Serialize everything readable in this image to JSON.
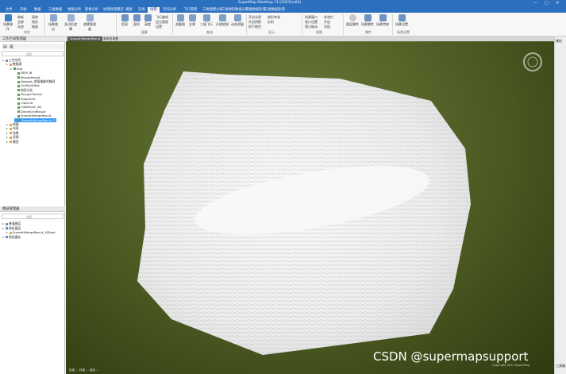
{
  "window": {
    "title": "SuperMap iDesktop 11i(2023)(x64)",
    "controls": [
      "—",
      "□",
      "✕"
    ]
  },
  "menu": {
    "tabs": [
      "文件",
      "开始",
      "数据",
      "三维数据",
      "地图分析",
      "影像分析",
      "地理处理模型",
      "视图",
      "在线",
      "场景",
      "空间分析",
      "飞行管理",
      "三维建模分析",
      "三维地形数据分析",
      "三维数据处理",
      "三维数据处理"
    ],
    "active_index": 9
  },
  "ribbon": {
    "items_col1": [
      "刷新",
      "全屏",
      "动态"
    ],
    "items_col2": [
      "清除",
      "地形",
      "缩放"
    ],
    "big_buttons": [
      "场景操作",
      "场景输出",
      "多边形遮罩",
      "遮罩管理器",
      "距离",
      "面积",
      "高度",
      "测量图",
      "全景",
      "三维飞行",
      "开放地图",
      "动态测量",
      "视频投放"
    ],
    "col_a": [
      "飞行路线",
      "定位管理",
      "设置"
    ],
    "col_b": [
      "开启光照",
      "开启阴影",
      "地下颜色"
    ],
    "col_c": [
      "地形夸张",
      "反射"
    ],
    "col_d": [
      "场景窗口",
      "视口设置",
      "视口联动"
    ],
    "col_e": [
      "状态栏",
      "开启",
      "导航"
    ],
    "right_big": [
      "图层属性",
      "场景属性",
      "场景特效",
      "场景设置"
    ],
    "groups": [
      "浏览",
      "量算",
      "查询",
      "显示",
      "图层",
      "视图",
      "属性",
      "场景设置"
    ]
  },
  "workspace_panel": {
    "header": "工作空间管理器",
    "search_placeholder": "搜索",
    "tree": [
      {
        "label": "工作空间",
        "level": 0,
        "selected": false
      },
      {
        "label": "数据源",
        "level": 1,
        "selected": false
      },
      {
        "label": "test",
        "level": 2,
        "selected": false
      },
      {
        "label": "DEM_IN",
        "level": 3,
        "selected": false
      },
      {
        "label": "MosaicResult",
        "level": 3,
        "selected": false
      },
      {
        "label": "Dataset_地面抽象的格网",
        "level": 3,
        "selected": false
      },
      {
        "label": "GridSplitTest",
        "level": 3,
        "selected": false
      },
      {
        "label": "地形分析",
        "level": 3,
        "selected": false
      },
      {
        "label": "PolygonToGrid",
        "level": 3,
        "selected": false
      },
      {
        "label": "SlopeGrid",
        "level": 3,
        "selected": false
      },
      {
        "label": "ClipGrid",
        "level": 3,
        "selected": false
      },
      {
        "label": "ClipResult_3D",
        "level": 3,
        "selected": false
      },
      {
        "label": "DivideGridResult",
        "level": 3,
        "selected": false
      },
      {
        "label": "SmoothMergeResult",
        "level": 3,
        "selected": false
      },
      {
        "label": "SmoothMergeResult_1",
        "level": 3,
        "selected": true
      },
      {
        "label": "地图",
        "level": 1,
        "selected": false
      },
      {
        "label": "布局",
        "level": 1,
        "selected": false
      },
      {
        "label": "场景",
        "level": 1,
        "selected": false
      },
      {
        "label": "资源",
        "level": 1,
        "selected": false
      },
      {
        "label": "模型",
        "level": 1,
        "selected": false
      }
    ]
  },
  "layer_panel": {
    "header": "图层管理器",
    "search_placeholder": "搜索",
    "tree": [
      {
        "label": "普通图层",
        "level": 0
      },
      {
        "label": "地形图层",
        "level": 0
      },
      {
        "label": "SmoothMergeResult_1@test",
        "level": 1
      },
      {
        "label": "地形缓存",
        "level": 0
      }
    ]
  },
  "doc_tabs": [
    "SmoothMergeResult",
    "未命名场景"
  ],
  "right_strip": [
    "属性",
    "工具箱"
  ],
  "scene": {
    "watermark": "CSDN @supermapsupport",
    "copyright": "Copyright 2023 SuperMap",
    "status": "经度 ... 纬度 ... 高度 ...",
    "terrain_color": "#f4f4f4",
    "background_color": "#4c5a22"
  }
}
